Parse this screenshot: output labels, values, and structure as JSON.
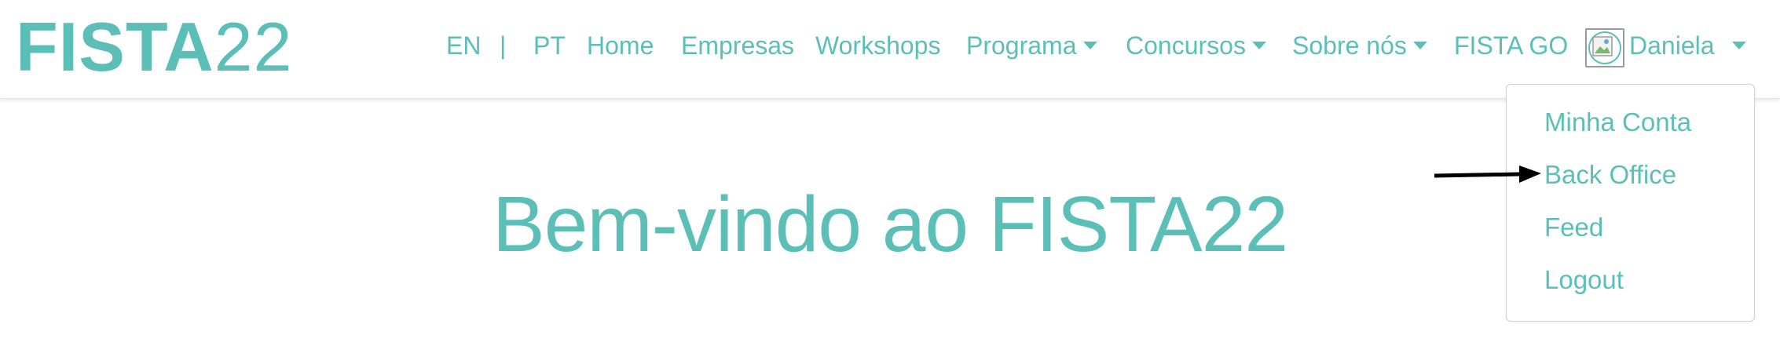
{
  "brand": {
    "bold": "FISTA",
    "light": "22"
  },
  "nav": {
    "lang_en": "EN",
    "separator": "|",
    "lang_pt": "PT",
    "home": "Home",
    "empresas": "Empresas",
    "workshops": "Workshops",
    "programa": "Programa",
    "concursos": "Concursos",
    "sobre": "Sobre nós",
    "fista_go": "FISTA GO",
    "user": "Daniela"
  },
  "user_menu": {
    "items": [
      "Minha Conta",
      "Back Office",
      "Feed",
      "Logout"
    ]
  },
  "hero": {
    "title": "Bem-vindo ao FISTA22"
  },
  "colors": {
    "accent": "#5bbfb8",
    "arrow": "#000000"
  },
  "icons": {
    "avatar": "broken-image-icon",
    "caret": "caret-down-icon",
    "annotation": "arrow-right-icon"
  }
}
